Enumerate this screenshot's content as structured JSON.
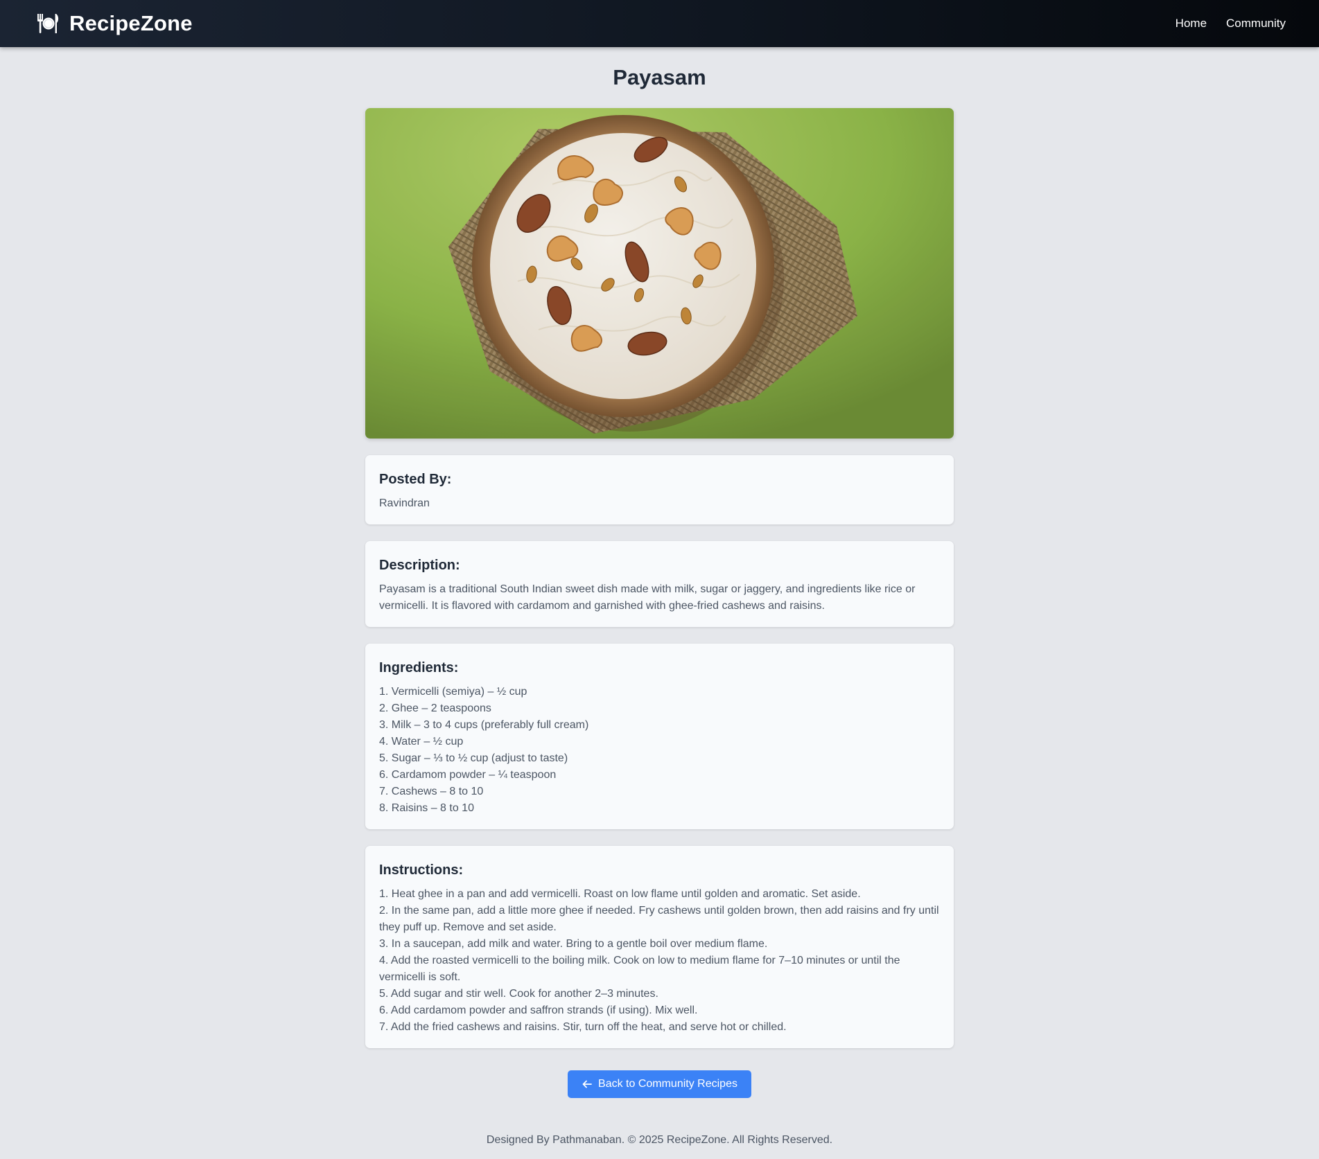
{
  "navbar": {
    "brand": "RecipeZone",
    "brand_icon": "plate-fork-knife-icon",
    "links": [
      "Home",
      "Community"
    ]
  },
  "recipe": {
    "title": "Payasam",
    "image_alt": "Payasam",
    "posted_by_heading": "Posted By:",
    "posted_by": "Ravindran",
    "description_heading": "Description:",
    "description": "Payasam is a traditional South Indian sweet dish made with milk, sugar or jaggery, and ingredients like rice or vermicelli. It is flavored with cardamom and garnished with ghee-fried cashews and raisins.",
    "ingredients_heading": "Ingredients:",
    "ingredients": [
      "1. Vermicelli (semiya) – ½ cup",
      "2. Ghee – 2 teaspoons",
      "3. Milk – 3 to 4 cups (preferably full cream)",
      "4. Water – ½ cup",
      "5. Sugar – ⅓ to ½ cup (adjust to taste)",
      "6. Cardamom powder – ¼ teaspoon",
      "7. Cashews – 8 to 10",
      "8. Raisins – 8 to 10"
    ],
    "instructions_heading": "Instructions:",
    "instructions": [
      "1. Heat ghee in a pan and add vermicelli. Roast on low flame until golden and aromatic. Set aside.",
      "2. In the same pan, add a little more ghee if needed. Fry cashews until golden brown, then add raisins and fry until they puff up. Remove and set aside.",
      "3. In a saucepan, add milk and water. Bring to a gentle boil over medium flame.",
      "4. Add the roasted vermicelli to the boiling milk. Cook on low to medium flame for 7–10 minutes or until the vermicelli is soft.",
      "5. Add sugar and stir well. Cook for another 2–3 minutes.",
      "6. Add cardamom powder and saffron strands (if using). Mix well.",
      "7. Add the fried cashews and raisins. Stir, turn off the heat, and serve hot or chilled."
    ]
  },
  "back_button": {
    "label": "Back to Community Recipes",
    "icon": "arrow-left-icon"
  },
  "footer": {
    "text": "Designed By Pathmanaban. © 2025 RecipeZone. All Rights Reserved."
  },
  "colors": {
    "navbar_bg": "#1b2433",
    "page_bg": "#e5e7eb",
    "card_bg": "#f8fafc",
    "button_bg": "#3b82f6",
    "hero_bg": "#8fb84a"
  }
}
